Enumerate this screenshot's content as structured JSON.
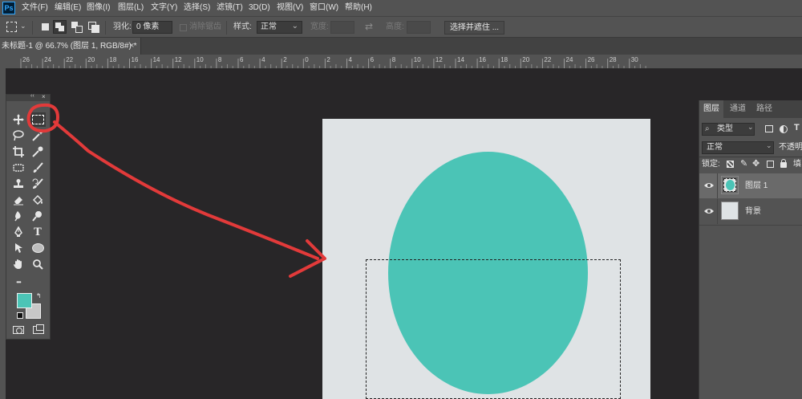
{
  "app": {
    "logo": "Ps"
  },
  "menu": [
    "文件(F)",
    "编辑(E)",
    "图像(I)",
    "图层(L)",
    "文字(Y)",
    "选择(S)",
    "滤镜(T)",
    "3D(D)",
    "视图(V)",
    "窗口(W)",
    "帮助(H)"
  ],
  "options": {
    "feather_label": "羽化:",
    "feather_value": "0 像素",
    "antialias_label": "消除锯齿",
    "style_label": "样式:",
    "style_value": "正常",
    "width_label": "宽度:",
    "height_label": "高度:",
    "select_mask_button": "选择并遮住 ..."
  },
  "document": {
    "tab_title": "未标题-1 @ 66.7% (图层 1, RGB/8#) *",
    "close_glyph": "×"
  },
  "ruler": {
    "ticks": [
      "26",
      "24",
      "22",
      "20",
      "18",
      "16",
      "14",
      "12",
      "10",
      "8",
      "6",
      "4",
      "2",
      "0",
      "2",
      "4",
      "6",
      "8",
      "10",
      "12",
      "14",
      "16",
      "18",
      "20",
      "22",
      "24",
      "26",
      "28",
      "30"
    ]
  },
  "toolbox": {
    "header_glyphs": [
      "‹‹",
      "×"
    ],
    "tools": [
      [
        "move-tool",
        "marquee-tool"
      ],
      [
        "lasso-tool",
        "magic-wand-tool"
      ],
      [
        "crop-tool",
        "eyedropper-tool"
      ],
      [
        "healing-brush-tool",
        "brush-tool"
      ],
      [
        "clone-stamp-tool",
        "history-brush-tool"
      ],
      [
        "eraser-tool",
        "paint-bucket-tool"
      ],
      [
        "blur-tool",
        "dodge-tool"
      ],
      [
        "pen-tool",
        "type-tool"
      ],
      [
        "path-selection-tool",
        "ellipse-tool"
      ],
      [
        "hand-tool",
        "zoom-tool"
      ]
    ],
    "type_glyph": "T",
    "more_glyph": "•••",
    "foreground_color": "#4bc4b6",
    "background_color": "#c8c8c8"
  },
  "canvas": {
    "background_color": "#dfe3e5",
    "shape_color": "#4bc4b6"
  },
  "annotation": {
    "color": "#e23a3a"
  },
  "layers_panel": {
    "tabs": [
      "图层",
      "通道",
      "路径"
    ],
    "filter_label": "类型",
    "blend_mode": "正常",
    "opacity_label": "不透明",
    "lock_label": "锁定:",
    "fill_label": "填",
    "layers": [
      {
        "name": "图层 1",
        "selected": true
      },
      {
        "name": "背景",
        "selected": false
      }
    ]
  }
}
